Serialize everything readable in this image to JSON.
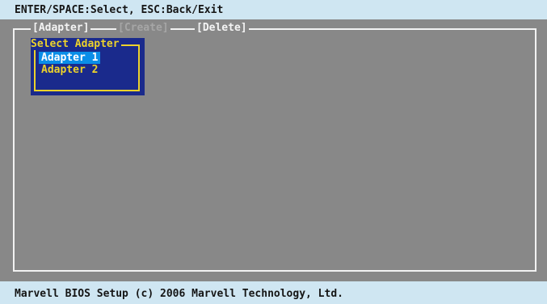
{
  "header": {
    "help_text": "ENTER/SPACE:Select, ESC:Back/Exit"
  },
  "tabs": [
    {
      "label": "[Adapter]",
      "state": "active"
    },
    {
      "label": "[Create]",
      "state": "disabled"
    },
    {
      "label": "[Delete]",
      "state": "normal"
    }
  ],
  "dialog": {
    "title": "Select Adapter",
    "options": [
      "Adapter 1",
      "Adapter 2"
    ],
    "selected_index": 0
  },
  "footer": {
    "copyright": "Marvell BIOS Setup (c) 2006 Marvell Technology, Ltd."
  },
  "colors": {
    "bar_bg": "#cfe6f2",
    "workspace_bg": "#888888",
    "dialog_bg": "#1a2a8c",
    "dialog_border": "#ecd22b",
    "selection_bg": "#0a8ee8"
  }
}
